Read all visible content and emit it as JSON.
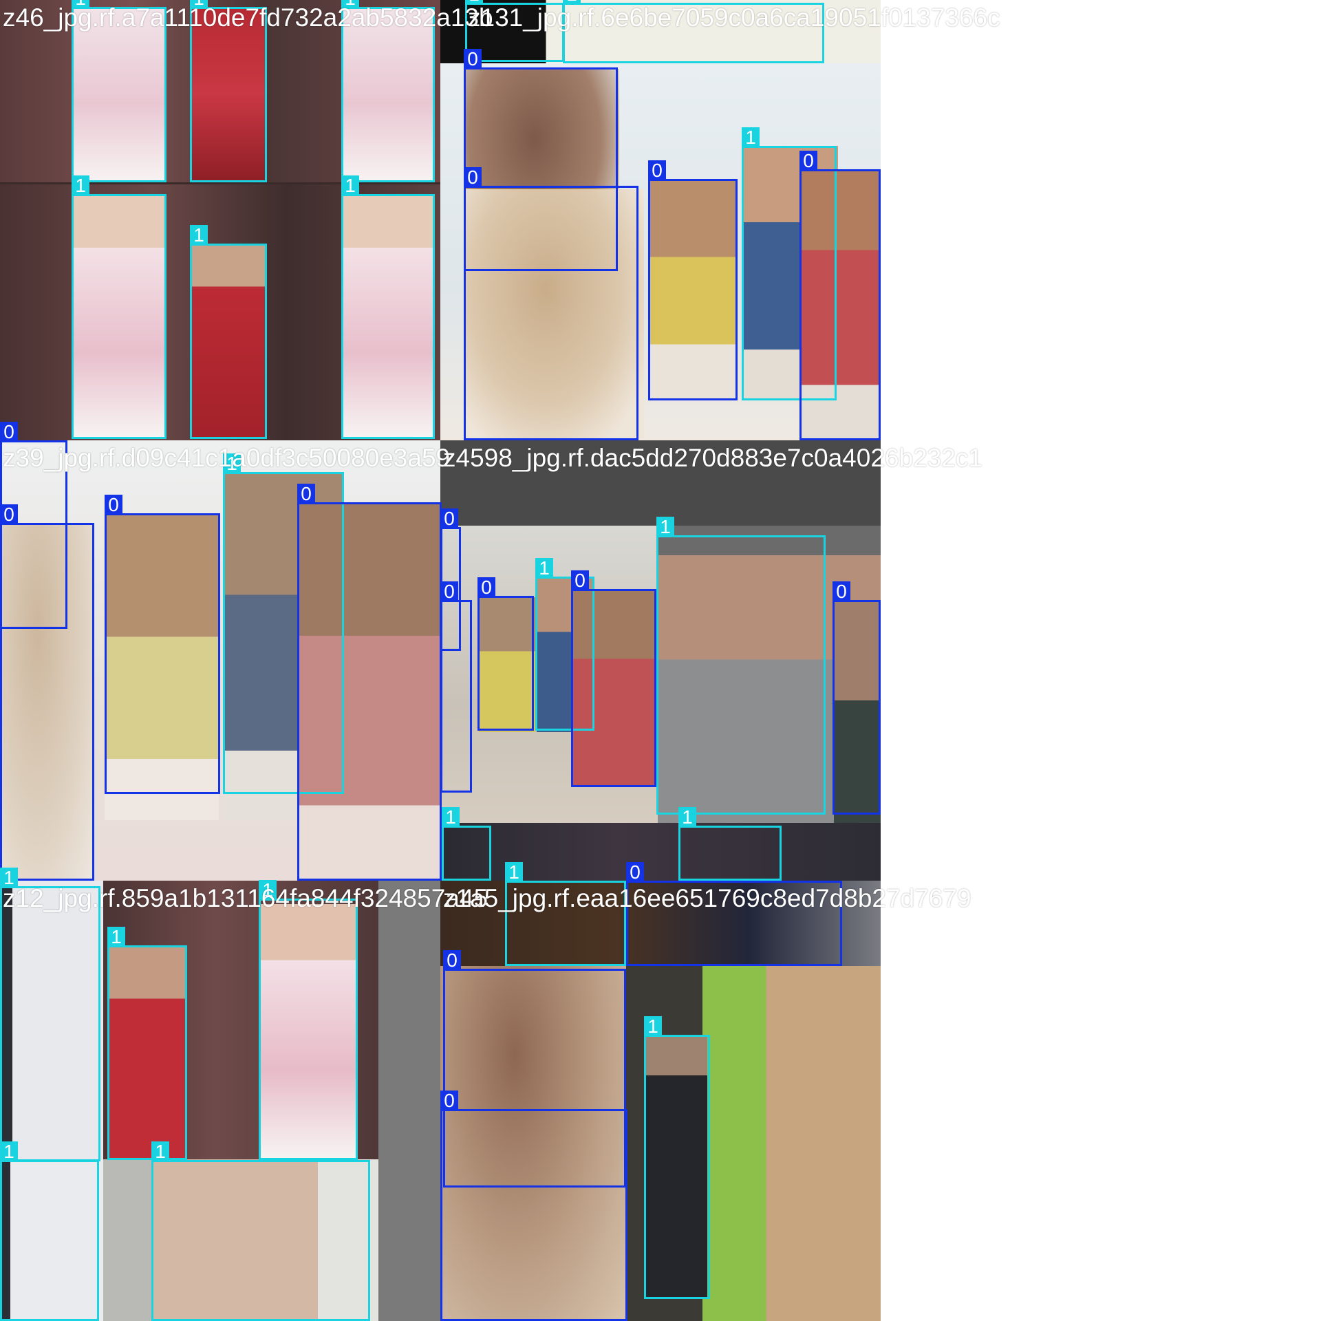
{
  "mosaic": {
    "class_colors": {
      "0": "#1433e6",
      "1": "#19d4e0"
    },
    "captions": {
      "top_left": "z46_jpg.rf.a7a1110de7fd732a2ab5832a13b",
      "top_right": "z131_jpg.rf.6e6be7059c0a6ca19051f0137366c",
      "middle_left": "z39_jpg.rf.d09c41c1a0df3c50080e3a59",
      "middle_right": "z4598_jpg.rf.dac5dd270d883e7c0a4026b232c1",
      "bottom_left": "z12_jpg.rf.859a1b131164fa844f324857a45",
      "bottom_right": "z1a5_jpg.rf.eaa16ee651769c8ed7d8b27d7679"
    },
    "box_labels": {
      "zero": "0",
      "one": "1"
    }
  }
}
